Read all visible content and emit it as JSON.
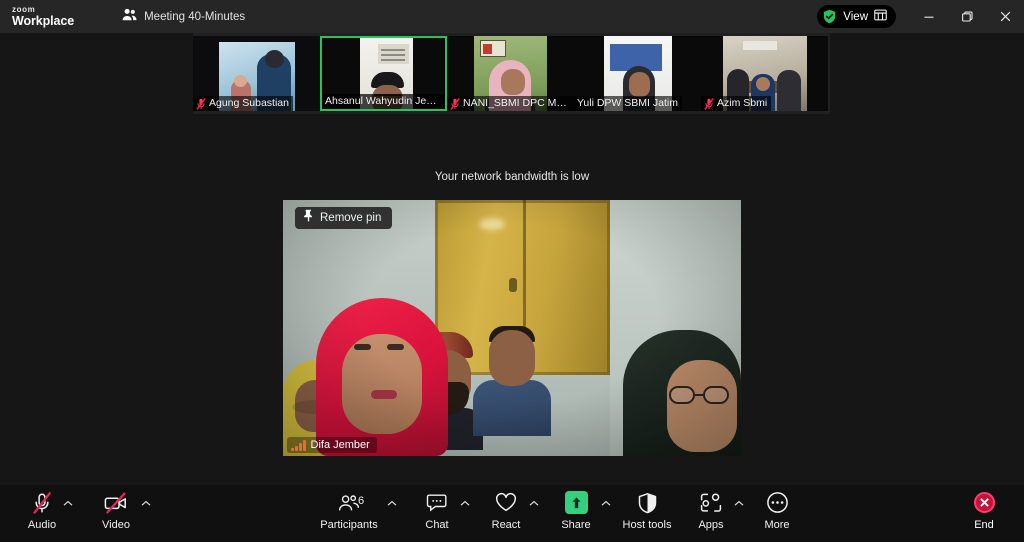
{
  "window": {
    "app_name_top": "zoom",
    "app_name_bottom": "Workplace",
    "meeting_title": "Meeting 40-Minutes",
    "meeting_icon": "participants-group-icon",
    "security_icon": "green-shield-check-icon",
    "view_label": "View",
    "view_icon": "grid-layout-icon",
    "minimize_icon": "minimize-icon",
    "maximize_icon": "restore-window-icon",
    "close_icon": "close-icon"
  },
  "filmstrip": {
    "thumbnails": [
      {
        "name": "Agung Subastian",
        "muted": true,
        "active_speaker": false
      },
      {
        "name": "Ahsanul Wahyudin Jember",
        "muted": false,
        "active_speaker": true
      },
      {
        "name": "NANI_SBMI DPC MAL...",
        "muted": true,
        "active_speaker": false
      },
      {
        "name": "Yuli DPW SBMI Jatim",
        "muted": false,
        "active_speaker": false
      },
      {
        "name": "Azim Sbmi",
        "muted": true,
        "active_speaker": false
      }
    ],
    "active_border_color": "#22c55e",
    "muted_icon": "microphone-muted-icon"
  },
  "notice": {
    "text": "Your network bandwidth is low"
  },
  "stage": {
    "pin_button_label": "Remove pin",
    "pin_icon": "pin-icon",
    "participant_name": "Difa Jember",
    "signal_icon": "weak-signal-bars-icon",
    "signal_color": "#f06a2a"
  },
  "toolbar": {
    "items": [
      {
        "label": "Audio",
        "icon": "microphone-muted-icon",
        "caret": true,
        "muted": true
      },
      {
        "label": "Video",
        "icon": "camera-muted-icon",
        "caret": true,
        "muted": true
      },
      {
        "label": "Participants",
        "icon": "participants-icon",
        "caret": true,
        "count": "6"
      },
      {
        "label": "Chat",
        "icon": "chat-bubble-icon",
        "caret": true
      },
      {
        "label": "React",
        "icon": "heart-icon",
        "caret": true
      },
      {
        "label": "Share",
        "icon": "share-screen-icon",
        "caret": true
      },
      {
        "label": "Host tools",
        "icon": "shield-icon",
        "caret": false
      },
      {
        "label": "Apps",
        "icon": "apps-icon",
        "caret": true
      },
      {
        "label": "More",
        "icon": "more-ellipsis-icon",
        "caret": false
      }
    ],
    "end_label": "End",
    "end_icon": "end-call-icon",
    "share_color": "#35d07f",
    "end_color": "#c3143c",
    "muted_color": "#e8245a"
  }
}
